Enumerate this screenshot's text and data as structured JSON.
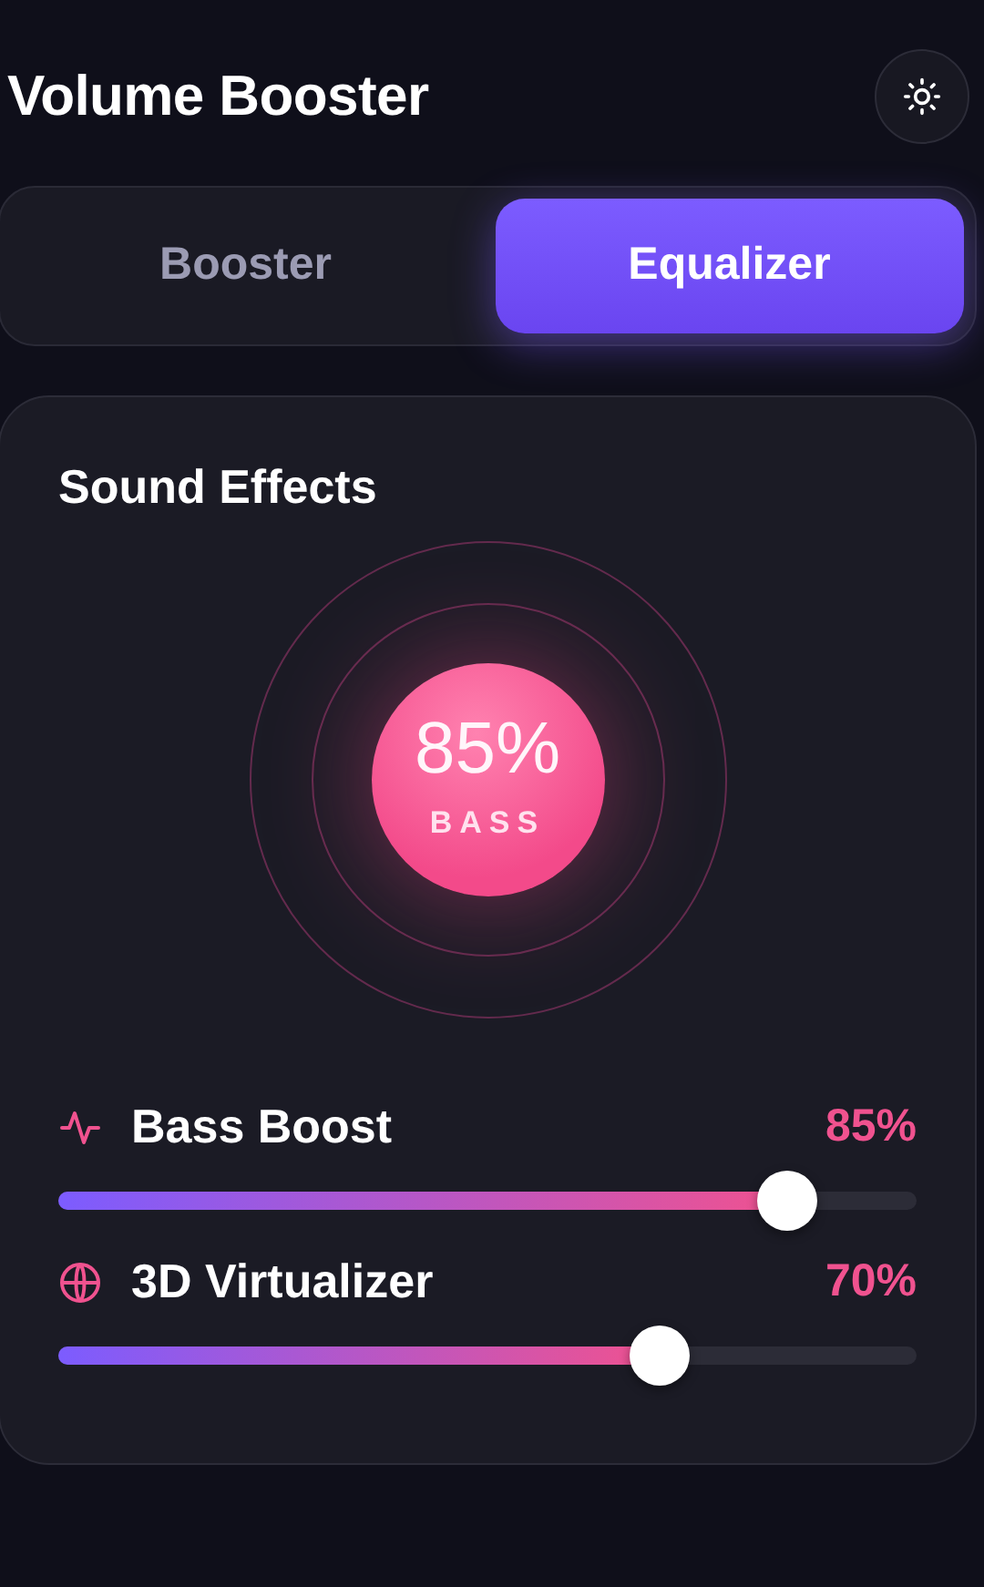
{
  "title": "Volume Booster",
  "tabs": [
    {
      "label": "Booster",
      "selected": false
    },
    {
      "label": "Equalizer",
      "selected": true
    }
  ],
  "card": {
    "title": "Sound Effects",
    "dial": {
      "value": "85%",
      "label": "BASS"
    }
  },
  "effects": [
    {
      "name": "Bass Boost",
      "reading": "85%",
      "level": 0.85
    },
    {
      "name": "3D Virtualizer",
      "reading": "70%",
      "level": 0.7
    }
  ]
}
